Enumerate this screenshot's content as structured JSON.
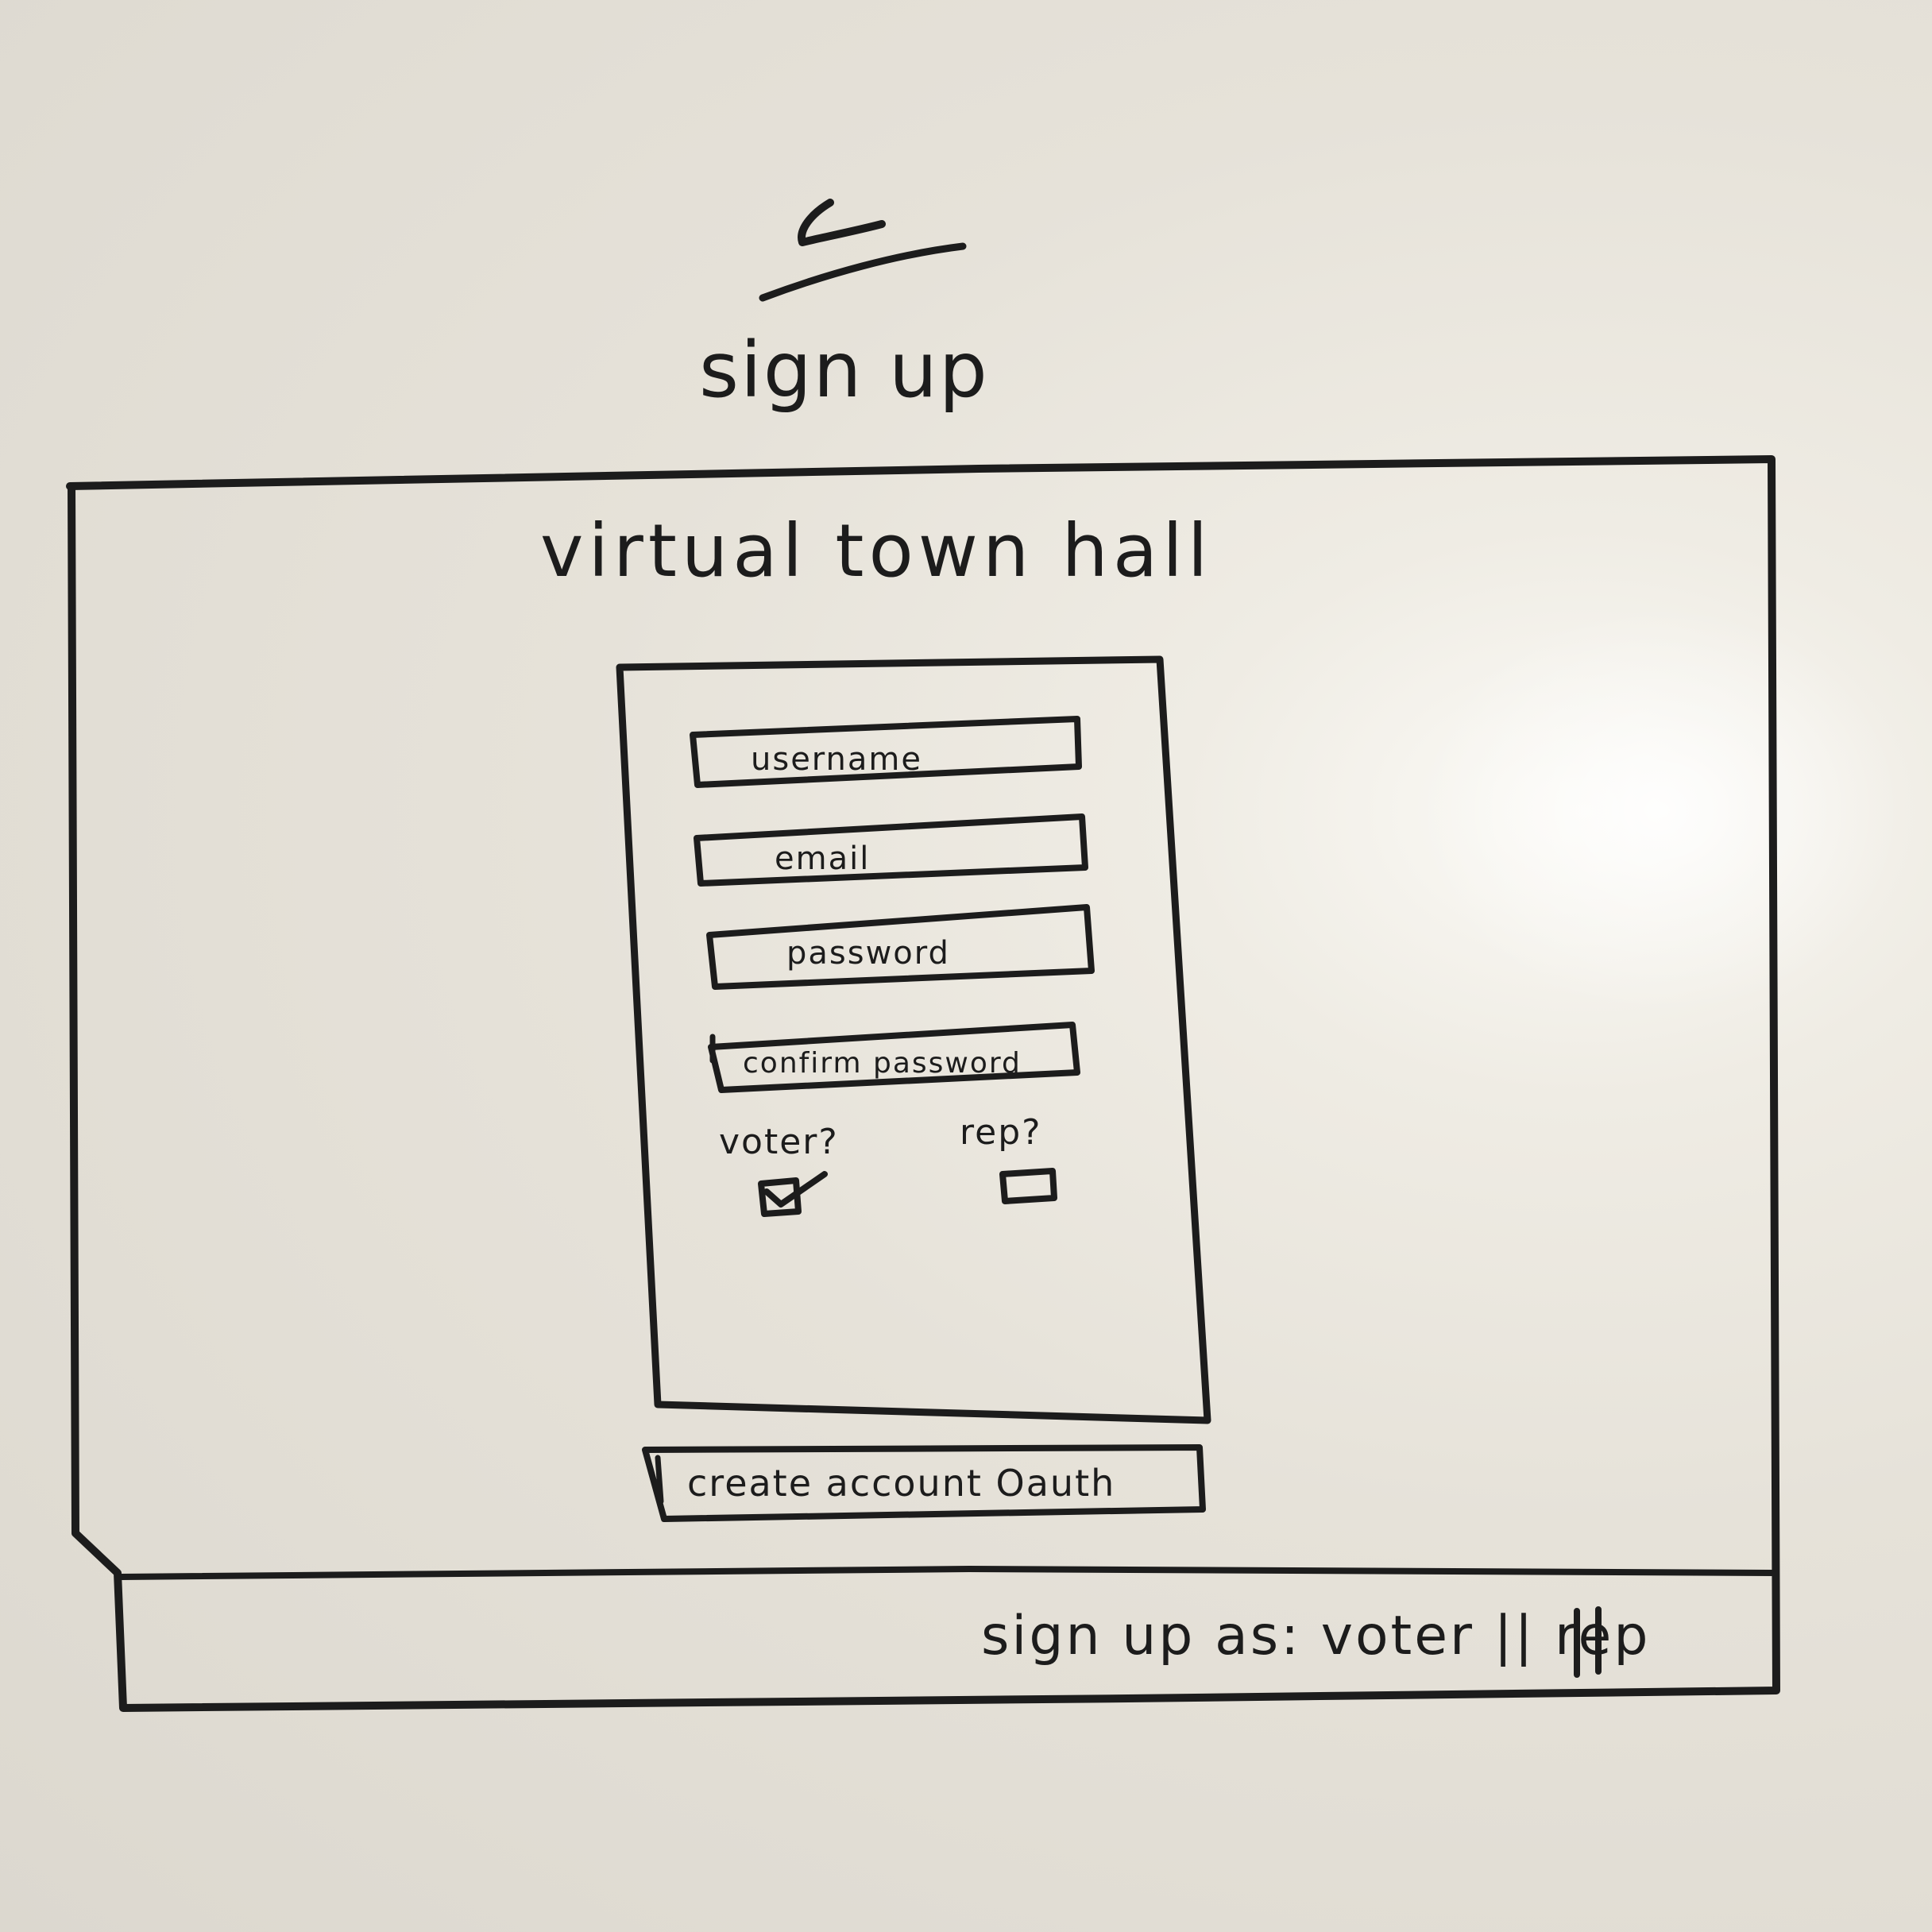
{
  "header": {
    "back_mark": "<",
    "heading": "sign up"
  },
  "app": {
    "title": "virtual town hall"
  },
  "form": {
    "fields": [
      {
        "placeholder": "username"
      },
      {
        "placeholder": "email"
      },
      {
        "placeholder": "password"
      },
      {
        "placeholder": "confirm password"
      }
    ],
    "checkboxes": [
      {
        "label": "voter?",
        "checked": true
      },
      {
        "label": "rep?",
        "checked": false
      }
    ],
    "submit_label": "create account Oauth"
  },
  "footer": {
    "label": "sign up as: voter || rep"
  },
  "colors": {
    "background": "#e6e2d9",
    "ink": "#1c1c1c"
  }
}
